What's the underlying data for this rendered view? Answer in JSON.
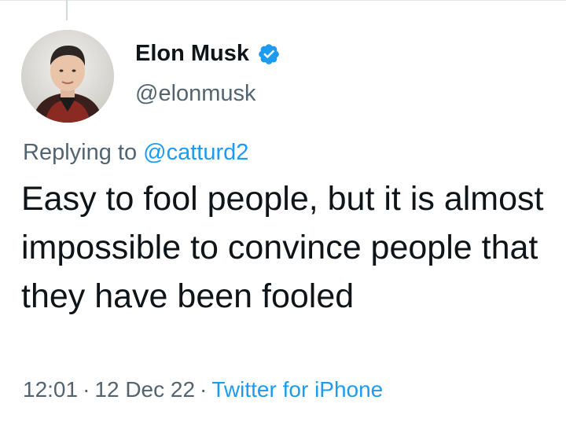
{
  "author": {
    "display_name": "Elon Musk",
    "handle": "@elonmusk",
    "verified": true,
    "avatar_icon": "profile-photo"
  },
  "reply": {
    "prefix": "Replying to",
    "user": "@catturd2"
  },
  "tweet": {
    "text": "Easy to fool people, but it is almost impossible to convince people that they have been fooled"
  },
  "meta": {
    "time": "12:01",
    "date": "12 Dec 22",
    "separator": "·",
    "source": "Twitter for iPhone"
  },
  "colors": {
    "accent": "#1d9bf0",
    "secondary_text": "#536471",
    "primary_text": "#0f1419"
  }
}
